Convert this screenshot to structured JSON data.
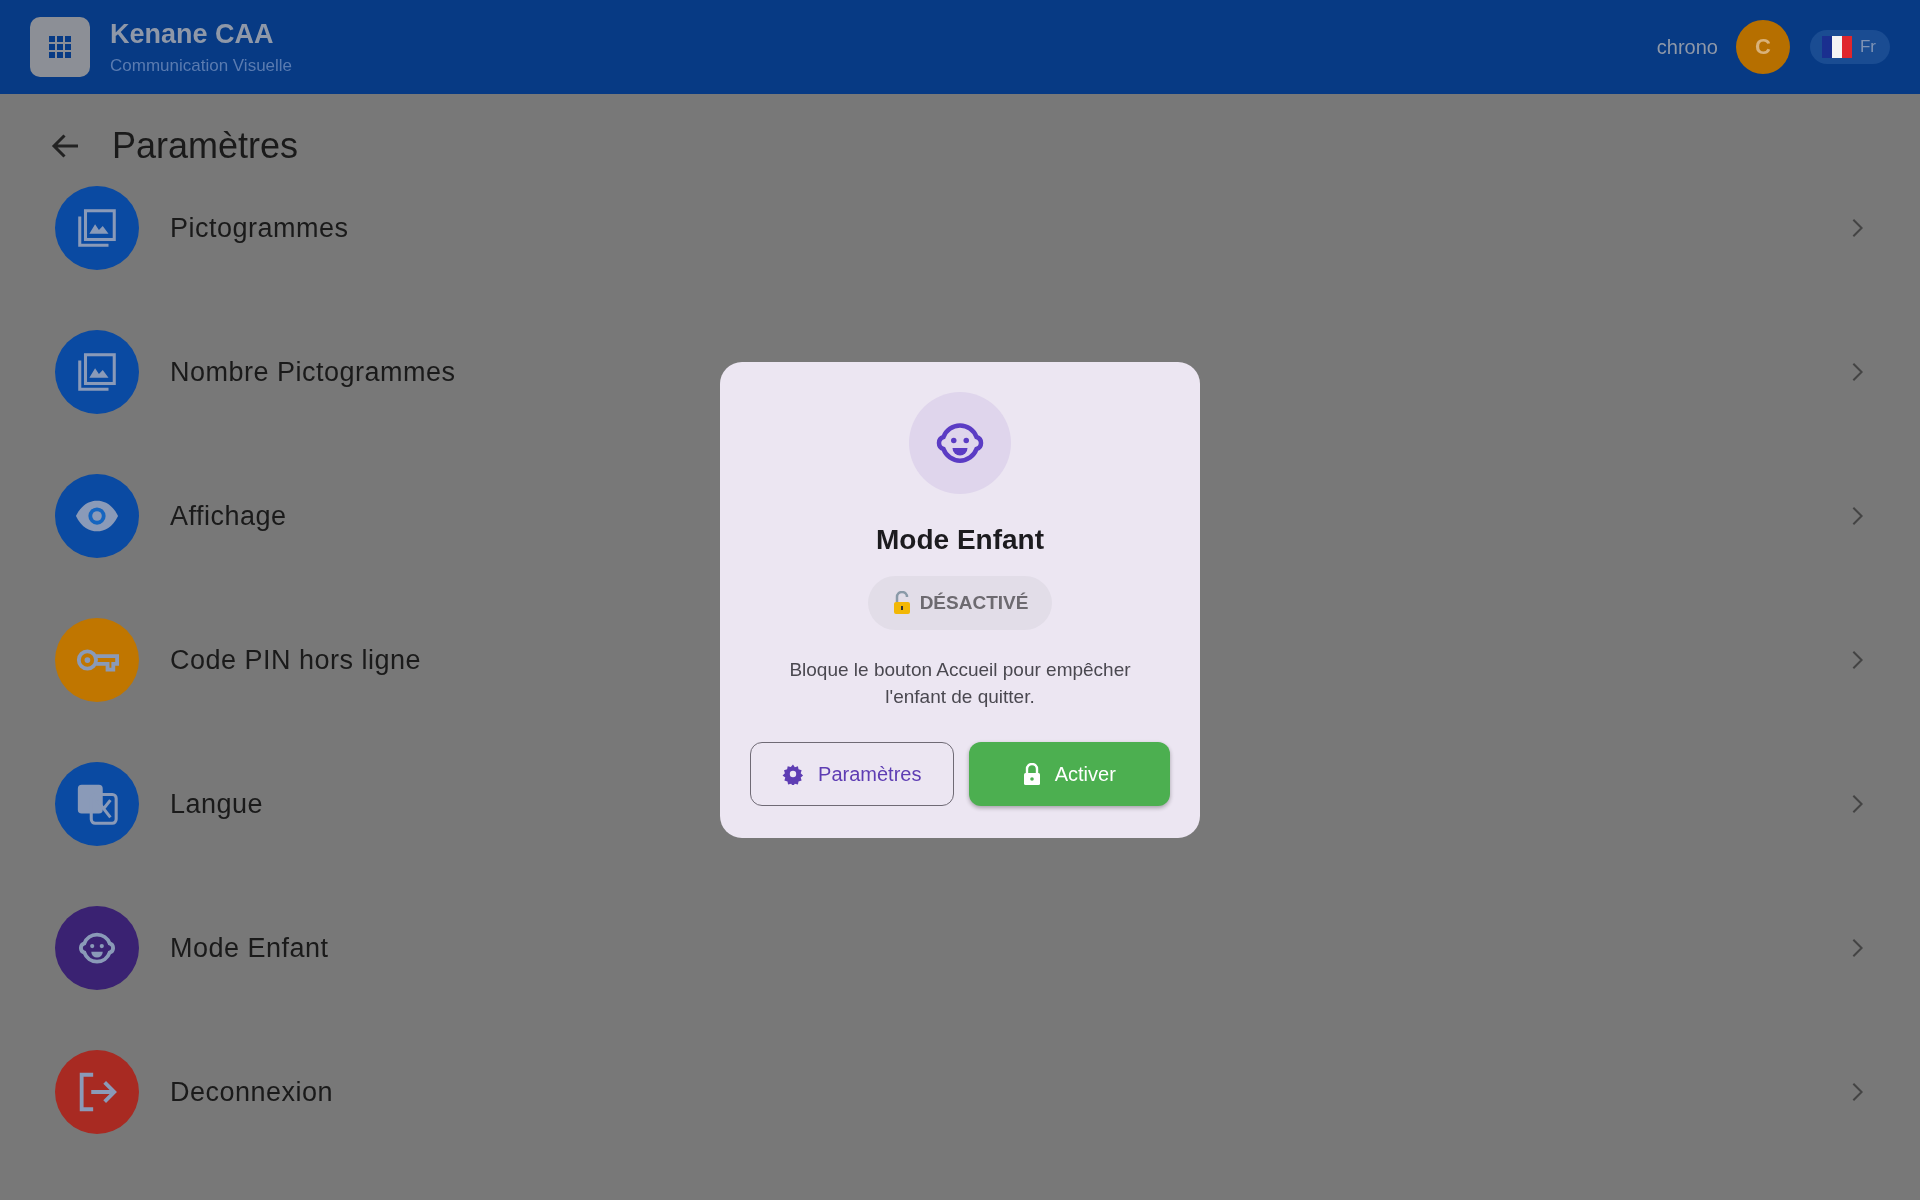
{
  "app_bar": {
    "title": "Kenane CAA",
    "subtitle": "Communication Visuelle",
    "user": "chrono",
    "avatar": "C",
    "language": "Fr"
  },
  "page": {
    "title": "Paramètres"
  },
  "settings_items": [
    {
      "label": "Pictogrammes",
      "color": "#0a4aa2"
    },
    {
      "label": "Nombre Pictogrammes",
      "color": "#0a4aa2"
    },
    {
      "label": "Affichage",
      "color": "#0a4aa2"
    },
    {
      "label": "Code PIN hors ligne",
      "color": "#c07600"
    },
    {
      "label": "Langue",
      "color": "#0a4aa2"
    },
    {
      "label": "Mode Enfant",
      "color": "#3a2272"
    },
    {
      "label": "Deconnexion",
      "color": "#a82a22"
    }
  ],
  "dialog": {
    "title": "Mode Enfant",
    "status": {
      "label": "DÉSACTIVÉ",
      "active": false
    },
    "description": "Bloque le bouton Accueil pour empêcher l'enfant de quitter.",
    "buttons": [
      {
        "label": "Paramètres",
        "kind": "outlined"
      },
      {
        "label": "Activer",
        "kind": "filled"
      }
    ]
  }
}
